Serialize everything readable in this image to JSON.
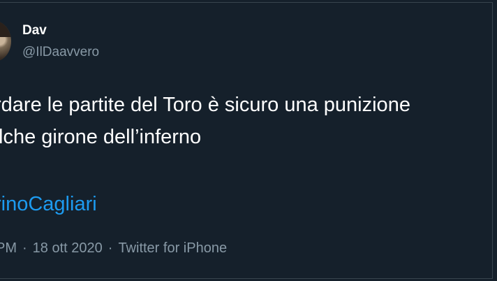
{
  "tweet": {
    "author": {
      "display_name": "Dav",
      "handle": "@IlDaavvero"
    },
    "text_lines": [
      "rdare le partite del Toro è sicuro una punizione",
      "lche girone dell’inferno"
    ],
    "hashtag": "rinoCagliari",
    "meta": {
      "time": "PM",
      "separator": "·",
      "date": "18 ott 2020",
      "source": "Twitter for iPhone"
    }
  },
  "colors": {
    "background": "#15202b",
    "text": "#ffffff",
    "secondary_text": "#8899a6",
    "link": "#1d9bf0"
  }
}
